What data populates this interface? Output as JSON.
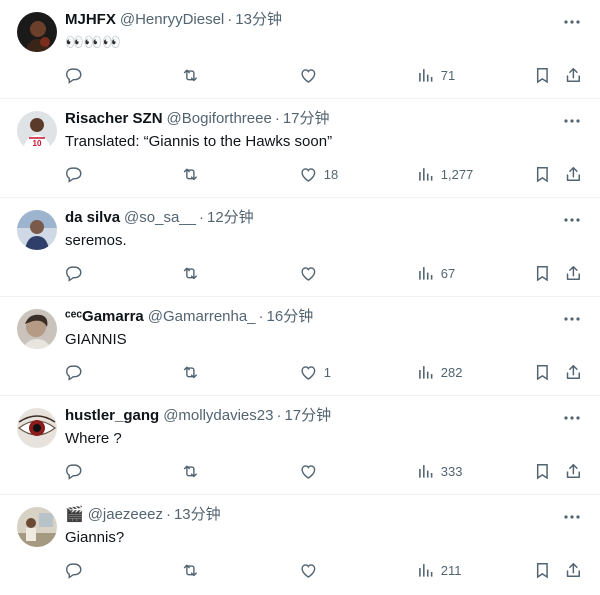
{
  "replies": [
    {
      "name": "MJHFX",
      "handle": "@HenryyDiesel",
      "separator": "·",
      "time": "13分钟",
      "text": "👀👀👀",
      "likes": "",
      "views": "71",
      "avatar": "avatar-photo-dark"
    },
    {
      "name": "Risacher SZN",
      "handle": "@Bogiforthreee",
      "separator": "·",
      "time": "17分钟",
      "text": "Translated: “Giannis to the Hawks soon”",
      "likes": "18",
      "views": "1,277",
      "avatar": "avatar-hawks-jersey"
    },
    {
      "name": "da silva",
      "handle": "@so_sa__",
      "separator": "·",
      "time": "12分钟",
      "text": "seremos.",
      "likes": "",
      "views": "67",
      "avatar": "avatar-photo-blue"
    },
    {
      "name": "ᶜᵉᶜGamarra",
      "handle": "@Gamarrenha_",
      "separator": "·",
      "time": "16分钟",
      "text": "GIANNIS",
      "likes": "1",
      "views": "282",
      "avatar": "avatar-photo-face"
    },
    {
      "name": "hustler_gang",
      "handle": "@mollydavies23",
      "separator": "·",
      "time": "17分钟",
      "text": "Where ?",
      "likes": "",
      "views": "333",
      "avatar": "avatar-eye"
    },
    {
      "name": "🎬",
      "handle": "@jaezeeez",
      "separator": "·",
      "time": "13分钟",
      "text": "Giannis?",
      "likes": "",
      "views": "211",
      "avatar": "avatar-photo-outdoor"
    }
  ],
  "colors": {
    "text": "#0f1419",
    "secondary": "#536471",
    "border": "#eff3f4"
  }
}
